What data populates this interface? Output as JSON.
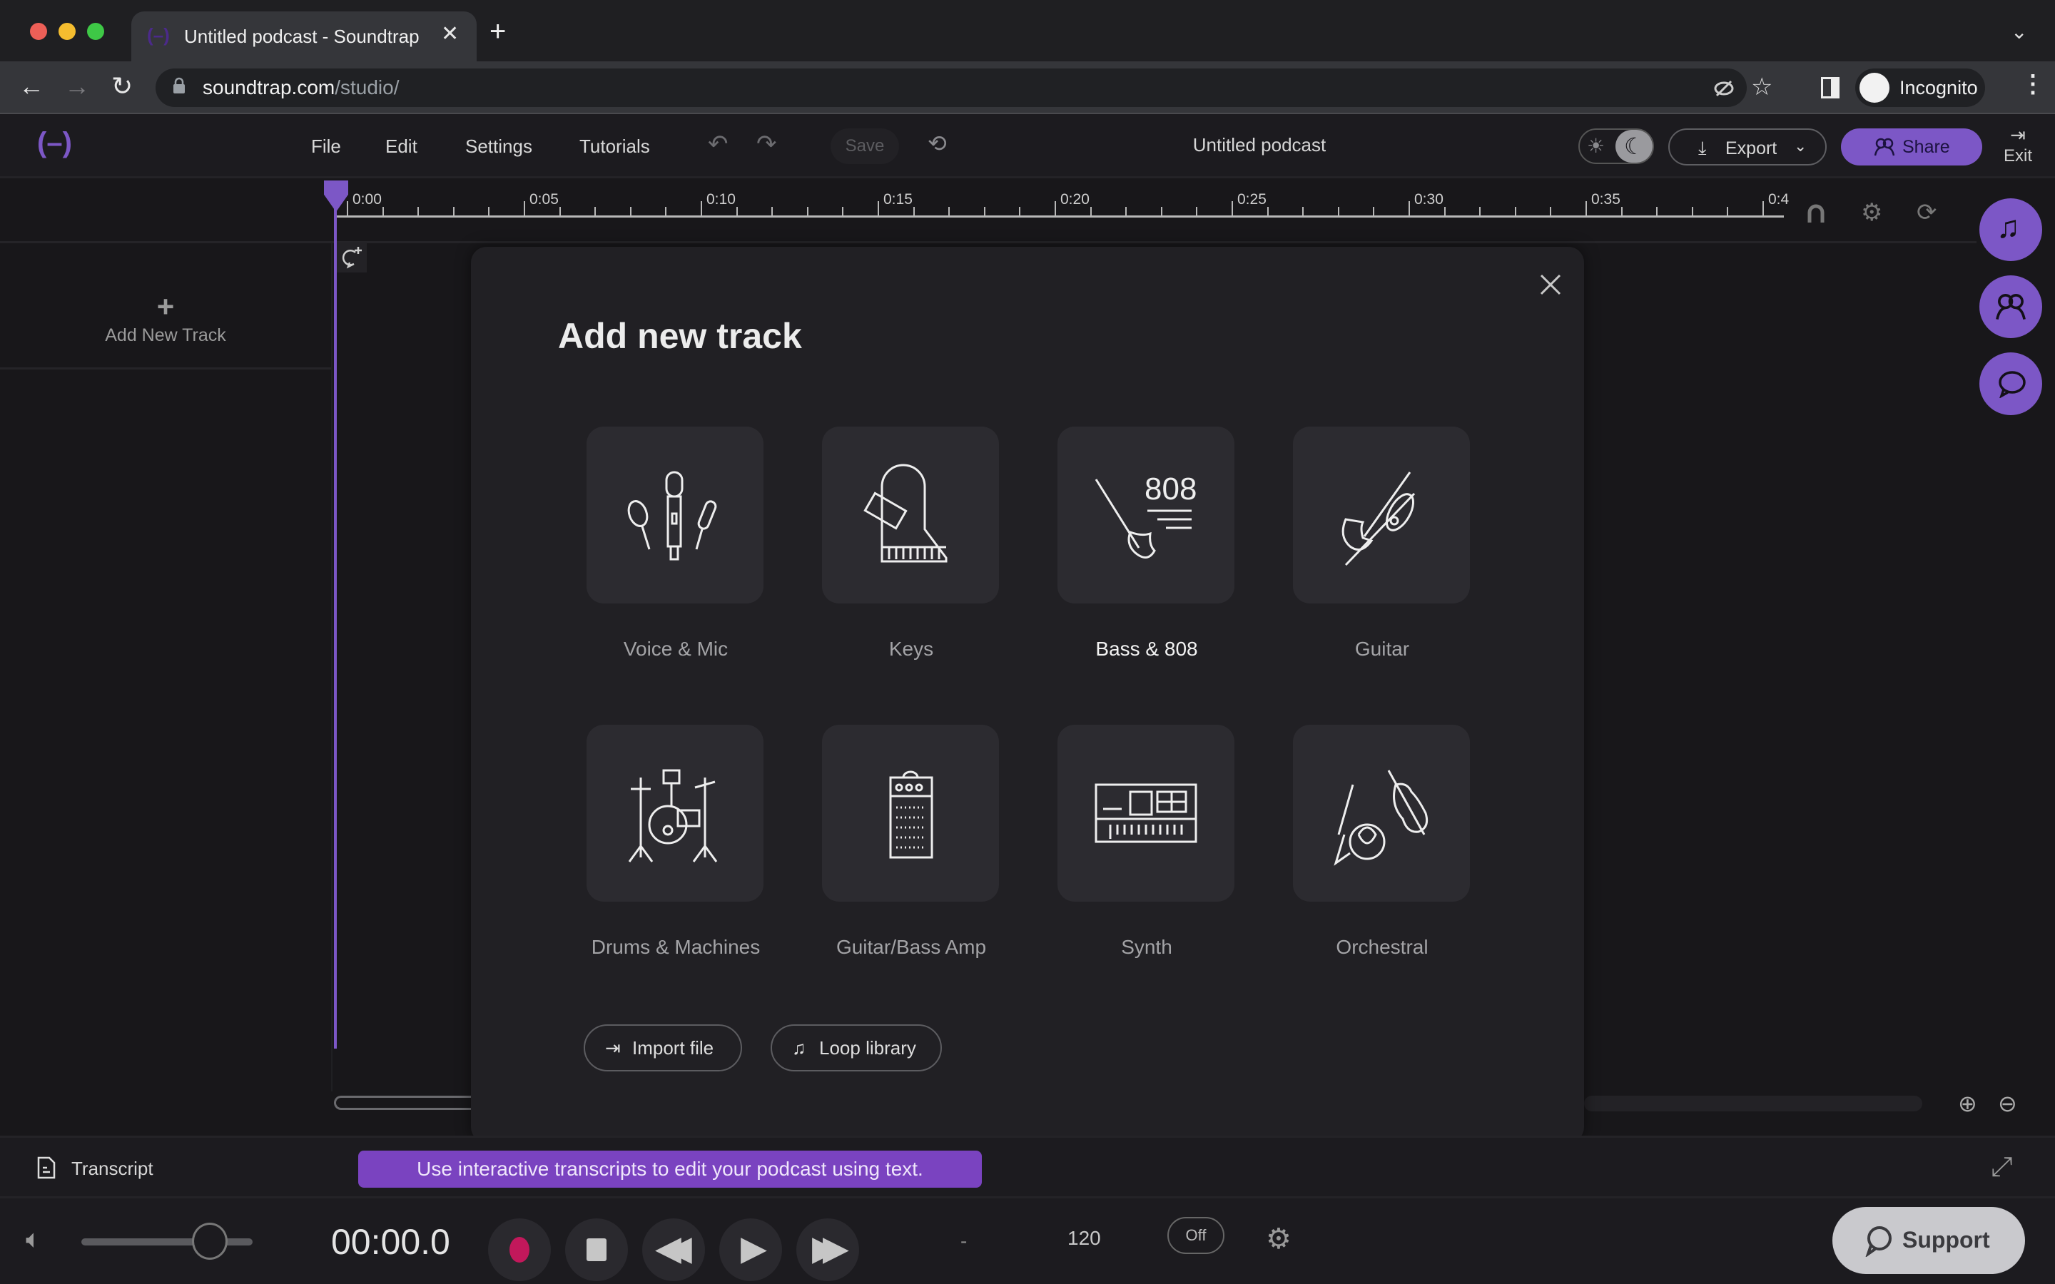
{
  "browser": {
    "tab_title": "Untitled podcast - Soundtrap",
    "new_tab_icon": "plus-icon",
    "url_domain": "soundtrap.com",
    "url_path": "/studio/",
    "profile_label": "Incognito"
  },
  "header": {
    "menu": [
      "File",
      "Edit",
      "Settings",
      "Tutorials"
    ],
    "save_label": "Save",
    "project_title": "Untitled podcast",
    "export_label": "Export",
    "share_label": "Share",
    "exit_label": "Exit",
    "theme": "dark"
  },
  "timeline": {
    "ruler_labels": [
      "0:00",
      "0:05",
      "0:10",
      "0:15",
      "0:20",
      "0:25",
      "0:30",
      "0:35",
      "0:4"
    ],
    "add_track_label": "Add New Track"
  },
  "side_fabs": [
    "music-note-icon",
    "collaborators-icon",
    "chat-icon"
  ],
  "modal": {
    "title": "Add new track",
    "instruments": [
      {
        "label": "Voice & Mic",
        "icon": "microphones-icon"
      },
      {
        "label": "Keys",
        "icon": "piano-icon"
      },
      {
        "label": "Bass & 808",
        "icon": "bass-808-icon",
        "hovered": true
      },
      {
        "label": "Guitar",
        "icon": "guitars-icon"
      },
      {
        "label": "Drums & Machines",
        "icon": "drum-kit-icon"
      },
      {
        "label": "Guitar/Bass Amp",
        "icon": "amplifier-icon"
      },
      {
        "label": "Synth",
        "icon": "synthesizer-icon"
      },
      {
        "label": "Orchestral",
        "icon": "orchestral-icon"
      }
    ],
    "import_label": "Import file",
    "loop_label": "Loop library"
  },
  "transcript": {
    "label": "Transcript",
    "tip": "Use interactive transcripts to edit your podcast using text."
  },
  "transport": {
    "time": "00:00.0",
    "volume_fraction": 0.75,
    "key": "-",
    "tempo": "120",
    "metronome": "Off",
    "support_label": "Support"
  },
  "colors": {
    "accent": "#7c57c6",
    "record": "#c2185b",
    "tip_bg": "#7a43c0"
  }
}
